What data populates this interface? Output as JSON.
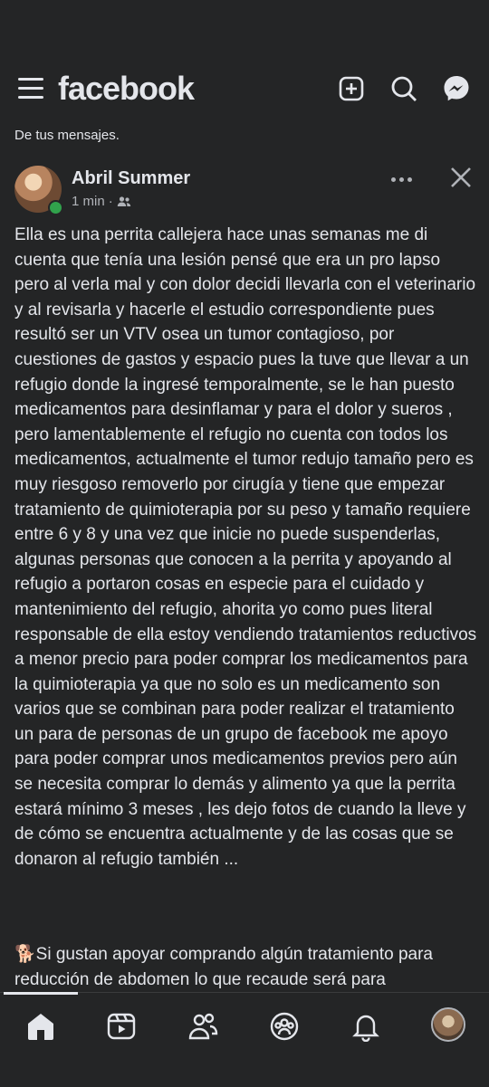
{
  "header": {
    "logo_text": "facebook",
    "icons": [
      "menu-icon",
      "create-icon",
      "search-icon",
      "messenger-icon"
    ]
  },
  "breadcrumb": "De tus mensajes.",
  "post": {
    "author": "Abril Summer",
    "time": "1 min",
    "audience_icon": "friends-icon",
    "text": "Ella es una perrita callejera hace unas semanas me di cuenta que tenía una lesión pensé que era un pro lapso pero al verla mal y con dolor decidi llevarla con el veterinario y al revisarla y hacerle el estudio correspondiente pues resultó ser un VTV osea un tumor contagioso, por cuestiones de gastos y espacio pues la tuve que llevar a un refugio donde la ingresé temporalmente, se le han puesto medicamentos para desinflamar y para el dolor y sueros , pero lamentablemente el refugio no cuenta con todos los medicamentos, actualmente el tumor redujo tamaño pero es muy riesgoso removerlo por cirugía y tiene que empezar tratamiento de quimioterapia por su peso y tamaño requiere entre 6 y 8 y una vez que inicie no puede suspenderlas, algunas personas que conocen a la perrita y apoyando al refugio a portaron cosas en especie para el cuidado y mantenimiento del refugio, ahorita yo como pues literal responsable de ella estoy vendiendo tratamientos reductivos a menor precio para poder comprar los medicamentos para la quimioterapia ya que no solo es un medicamento son varios que se combinan para poder realizar el tratamiento un para de personas de un grupo de facebook me apoyo para poder comprar unos medicamentos previos pero aún se necesita comprar lo demás y alimento ya que la perrita estará mínimo 3 meses , les dejo fotos de cuando la lleve y de cómo se encuentra actualmente y de las cosas que se donaron al refugio también ...",
    "text2": "🐕Si gustan apoyar comprando algún tratamiento para reducción de abdomen lo que recaude será para"
  },
  "nav": {
    "items": [
      "home-icon",
      "video-icon",
      "friends-icon",
      "groups-icon",
      "notifications-icon",
      "profile-avatar"
    ],
    "active": "home-icon"
  },
  "colors": {
    "background": "#242526",
    "text": "#e4e6eb",
    "secondary": "#b0b3b8",
    "online": "#31a24c"
  }
}
